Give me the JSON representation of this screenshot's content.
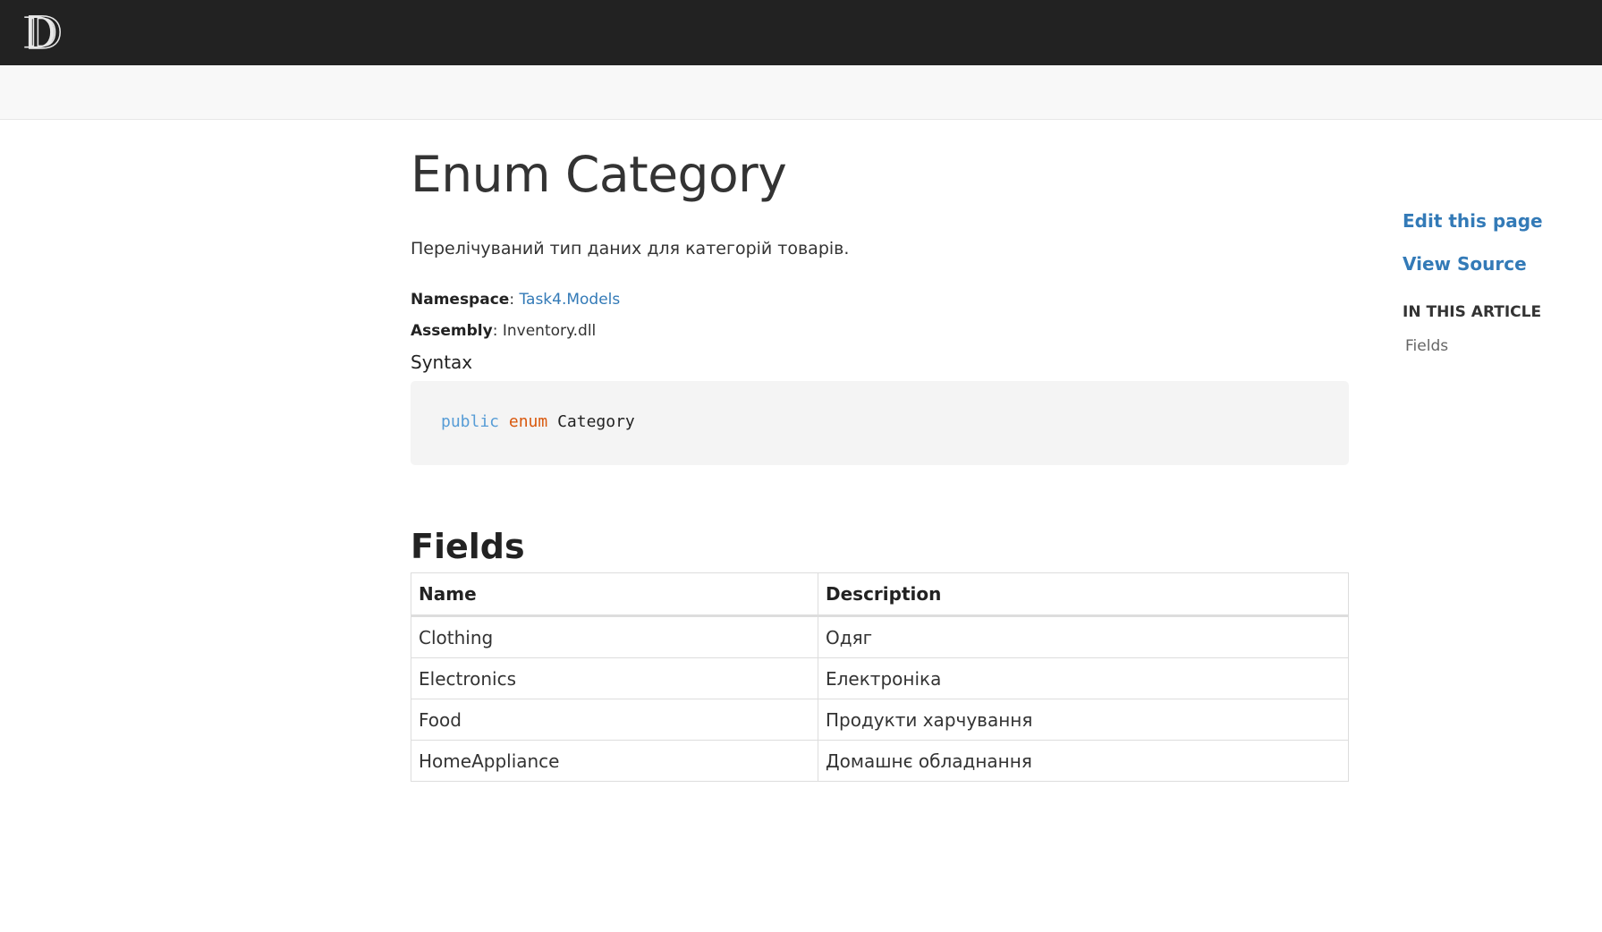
{
  "header": {
    "logo_icon": "docfx-logo-icon",
    "background": "#222222"
  },
  "article": {
    "title": "Enum Category",
    "summary": "Перелічуваний тип даних для категорій товарів.",
    "namespace_label": "Namespace",
    "namespace_value": "Task4.Models",
    "assembly_label": "Assembly",
    "assembly_value": "Inventory.dll",
    "syntax_heading": "Syntax",
    "code": {
      "keyword_public": "public",
      "keyword_enum": "enum",
      "type_name": "Category"
    },
    "fields_heading": "Fields",
    "table": {
      "headers": [
        "Name",
        "Description"
      ],
      "rows": [
        {
          "name": "Clothing",
          "description": "Одяг"
        },
        {
          "name": "Electronics",
          "description": "Електроніка"
        },
        {
          "name": "Food",
          "description": "Продукти харчування"
        },
        {
          "name": "HomeAppliance",
          "description": "Домашнє обладнання"
        }
      ]
    }
  },
  "sidebar": {
    "edit_link": "Edit this page",
    "source_link": "View Source",
    "in_article_label": "IN THIS ARTICLE",
    "toc_items": [
      "Fields"
    ]
  },
  "colors": {
    "link": "#337ab7",
    "keyword_public": "#569cd6",
    "keyword_enum": "#d9580d"
  }
}
